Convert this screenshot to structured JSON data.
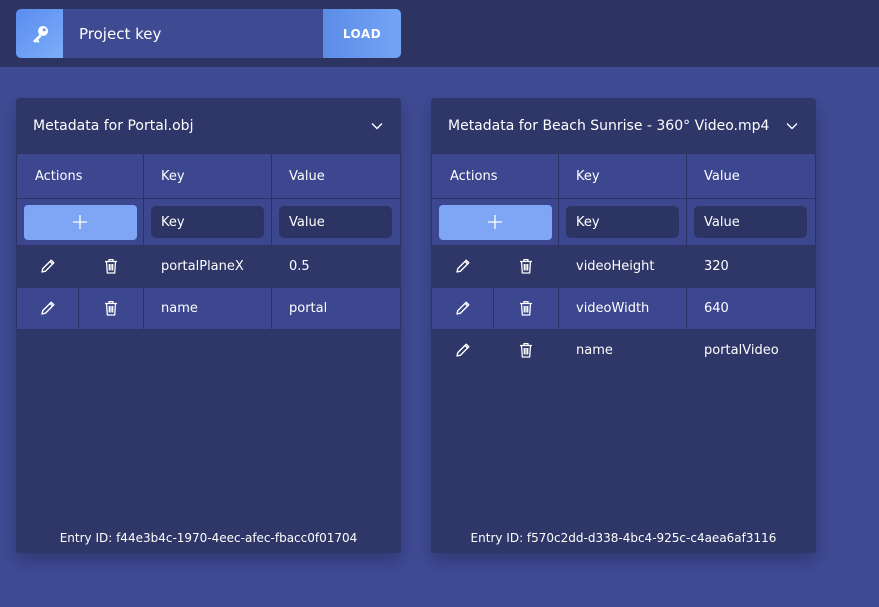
{
  "header": {
    "key_icon": "key-icon",
    "key_placeholder": "Project key",
    "load_label": "LOAD"
  },
  "cards": [
    {
      "title": "Metadata for Portal.obj",
      "columns": [
        "Actions",
        "Key",
        "Value"
      ],
      "new_key_placeholder": "Key",
      "new_value_placeholder": "Value",
      "rows": [
        {
          "key": "portalPlaneX",
          "value": "0.5"
        },
        {
          "key": "name",
          "value": "portal"
        }
      ],
      "entry_id": "Entry ID: f44e3b4c-1970-4eec-afec-fbacc0f01704"
    },
    {
      "title": "Metadata for Beach Sunrise - 360° Video.mp4",
      "columns": [
        "Actions",
        "Key",
        "Value"
      ],
      "new_key_placeholder": "Key",
      "new_value_placeholder": "Value",
      "rows": [
        {
          "key": "videoHeight",
          "value": "320"
        },
        {
          "key": "videoWidth",
          "value": "640"
        },
        {
          "key": "name",
          "value": "portalVideo"
        }
      ],
      "entry_id": "Entry ID: f570c2dd-d338-4bc4-925c-c4aea6af3116"
    }
  ],
  "icons": {
    "edit": "pencil-icon",
    "delete": "trash-icon",
    "add": "plus-icon",
    "collapse": "chevron-down-icon"
  },
  "colors": {
    "background": "#3f4b93",
    "topbar": "#2e3462",
    "card": "#2f3668",
    "row_alt": "#3c4790",
    "accent": "#7ea6f4"
  }
}
